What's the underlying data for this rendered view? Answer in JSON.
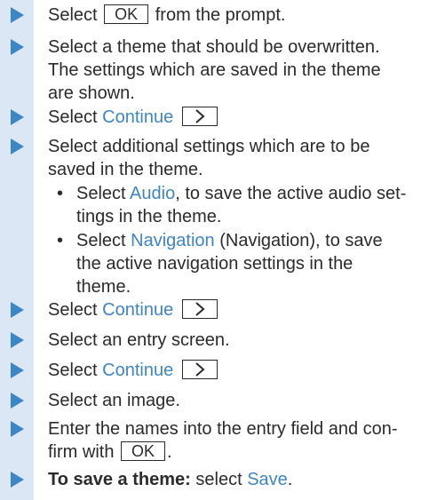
{
  "steps": [
    {
      "pre": "Select",
      "key": "OK",
      "post": "from the prompt."
    },
    {
      "lines": [
        "Select a theme that should be overwritten.",
        "The settings which are saved in the theme",
        "are shown."
      ]
    },
    {
      "pre": "Select",
      "link": "Continue"
    },
    {
      "lines": [
        "Select additional settings which are to be",
        "saved in the theme."
      ]
    },
    {
      "pre": "Select",
      "link": "Continue"
    },
    {
      "text": "Select an entry screen."
    },
    {
      "pre": "Select",
      "link": "Continue"
    },
    {
      "text": "Select an image."
    },
    {
      "line1": "Enter the names into the entry field and con-",
      "pre2": "firm with",
      "key": "OK",
      "post2": "."
    },
    {
      "bold": "To save a theme:",
      "pre": "select",
      "link": "Save",
      "post": "."
    }
  ],
  "sub_items": [
    {
      "pre": "Select",
      "link": "Audio",
      "post": ", to save the active audio set-",
      "line2": "tings in the theme."
    },
    {
      "pre": "Select",
      "link": "Navigation",
      "post": " (Navigation), to save",
      "line2": "the active navigation settings in the",
      "line3": "theme."
    }
  ],
  "icons": {
    "step_marker": "triangle-arrow-icon",
    "continue_key": "chevron-right-icon",
    "sub_bullet": "bullet-dot"
  },
  "colors": {
    "accent": "#3d86c6",
    "band": "#dbe7f4",
    "text": "#2b2b2b"
  }
}
